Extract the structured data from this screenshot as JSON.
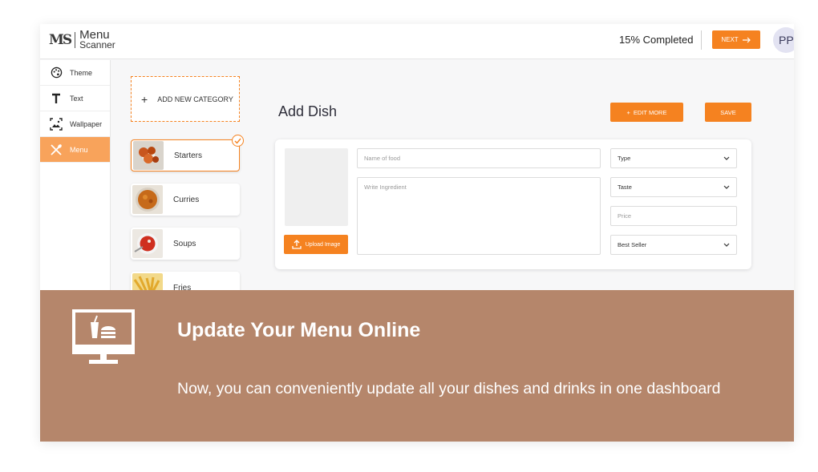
{
  "app": {
    "logo_mark": "MS",
    "logo_line1": "Menu",
    "logo_line2": "Scanner"
  },
  "header": {
    "progress": "15% Completed",
    "progress_value": 15,
    "next_label": "NEXT",
    "avatar_initials": "PP"
  },
  "sidebar": {
    "items": [
      {
        "label": "Theme",
        "icon": "palette-icon",
        "active": false
      },
      {
        "label": "Text",
        "icon": "text-t-icon",
        "active": false
      },
      {
        "label": "Wallpaper",
        "icon": "image-icon",
        "active": false
      },
      {
        "label": "Menu",
        "icon": "fork-spoon-icon",
        "active": true
      }
    ]
  },
  "categories": {
    "add_label": "ADD NEW CATEGORY",
    "items": [
      {
        "label": "Starters",
        "selected": true
      },
      {
        "label": "Curries",
        "selected": false
      },
      {
        "label": "Soups",
        "selected": false
      },
      {
        "label": "Fries",
        "selected": false
      }
    ]
  },
  "dish": {
    "title": "Add Dish",
    "edit_more_label": "EDIT MORE",
    "save_label": "SAVE",
    "upload_label": "Upload Image",
    "name_placeholder": "Name of food",
    "ingredient_placeholder": "Write Ingredient",
    "type_value": "Type",
    "taste_value": "Taste",
    "price_placeholder": "Price",
    "bestseller_value": "Best Seller"
  },
  "banner": {
    "title": "Update Your Menu Online",
    "description": "Now, you can conveniently update all your dishes and drinks in one dashboard"
  },
  "colors": {
    "accent": "#f58220",
    "banner": "#b5866b",
    "sidebar_active": "#f8a35b"
  }
}
